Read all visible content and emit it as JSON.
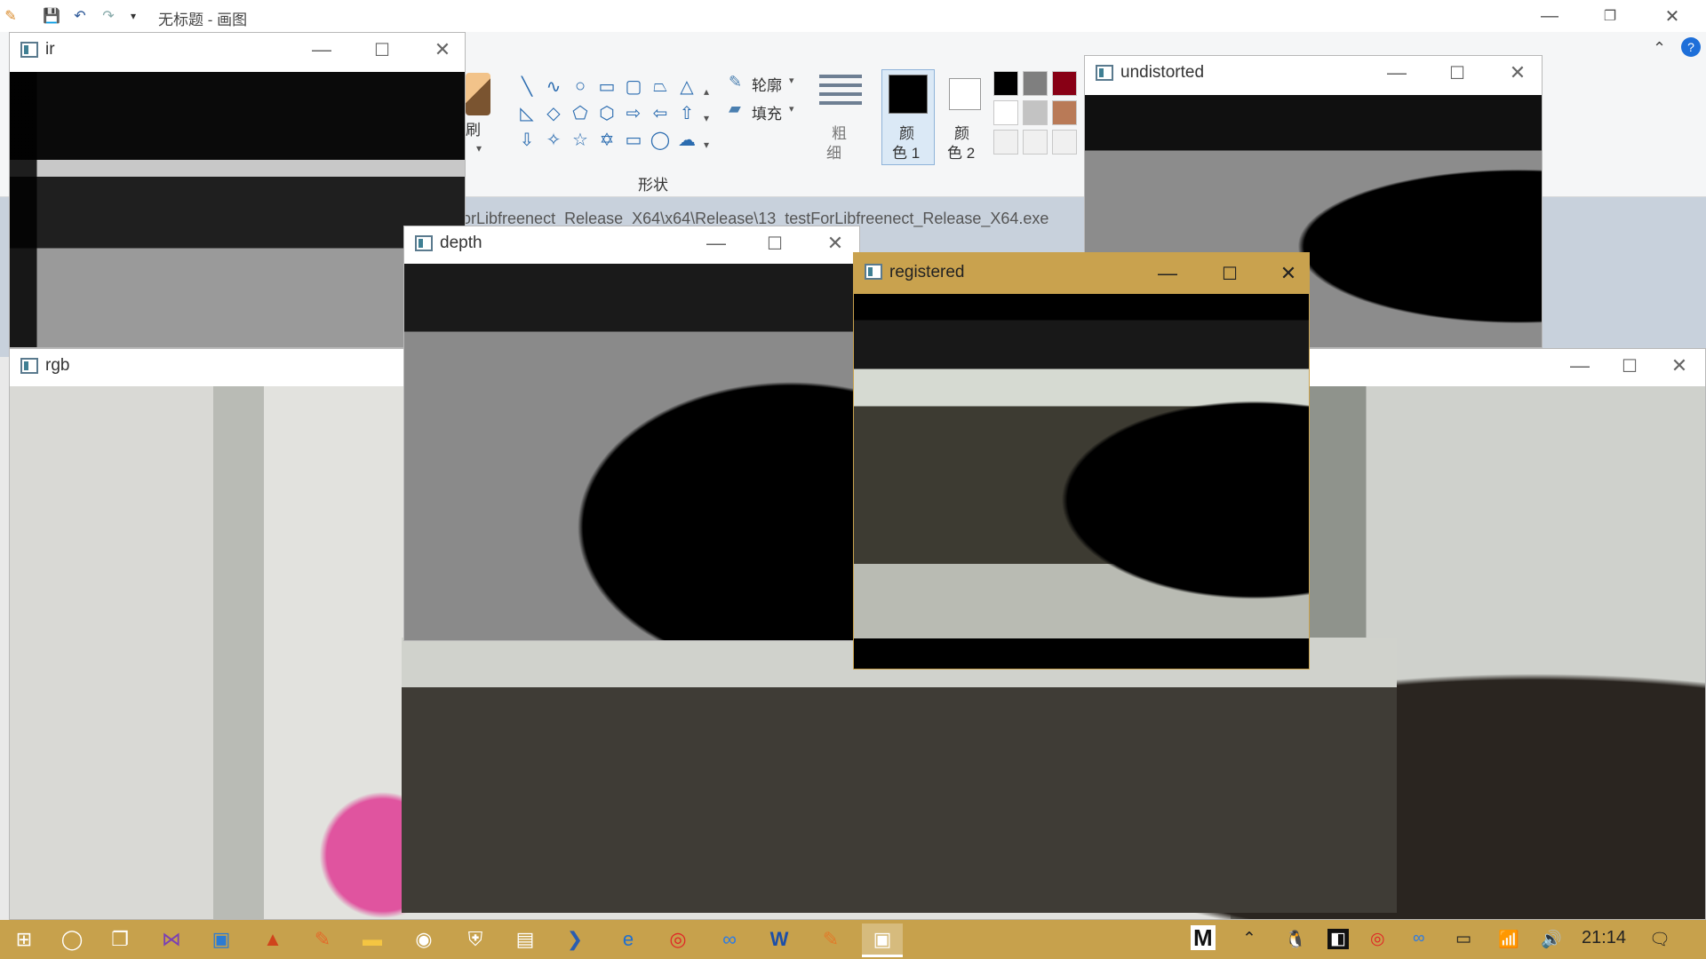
{
  "paint": {
    "title": "无标题 - 画图",
    "quick_access": [
      "save-icon",
      "undo-icon",
      "redo-icon",
      "customize-icon"
    ],
    "ribbon": {
      "brush_fragment": "刷",
      "outline_label": "轮廓",
      "fill_label": "填充",
      "shapes_group_label": "形状",
      "size_label_1": "粗",
      "size_label_2": "细",
      "color1_label_1": "颜",
      "color1_label_2": "色 1",
      "color2_label_1": "颜",
      "color2_label_2": "色 2",
      "palette": [
        "#000000",
        "#7f7f7f",
        "#880015",
        "#ffffff",
        "#c3c3c3",
        "#b97a57",
        "#f0f0f0",
        "#f0f0f0",
        "#f0f0f0"
      ],
      "color1_value": "#000000",
      "color2_value": "#ffffff"
    },
    "path_text": "orLibfreenect_Release_X64\\x64\\Release\\13_testForLibfreenect_Release_X64.exe"
  },
  "windows": {
    "ir": {
      "title": "ir"
    },
    "depth": {
      "title": "depth"
    },
    "registered": {
      "title": "registered"
    },
    "undistorted": {
      "title": "undistorted"
    },
    "rgb": {
      "title": "rgb"
    }
  },
  "window_controls": {
    "minimize": "—",
    "maximize": "☐",
    "close": "✕"
  },
  "taskbar": {
    "apps": [
      "start-icon",
      "cortana-icon",
      "task-view-icon",
      "visual-studio-icon",
      "remote-desktop-icon",
      "matlab-icon",
      "paint-icon",
      "file-explorer-icon",
      "chrome-icon",
      "security-icon",
      "notes-icon",
      "powershell-icon",
      "edge-icon",
      "netease-music-icon",
      "baidu-netdisk-icon",
      "word-icon",
      "paint-app-icon",
      "opencv-window-icon"
    ],
    "tray_letter": "M",
    "clock": "21:14"
  }
}
